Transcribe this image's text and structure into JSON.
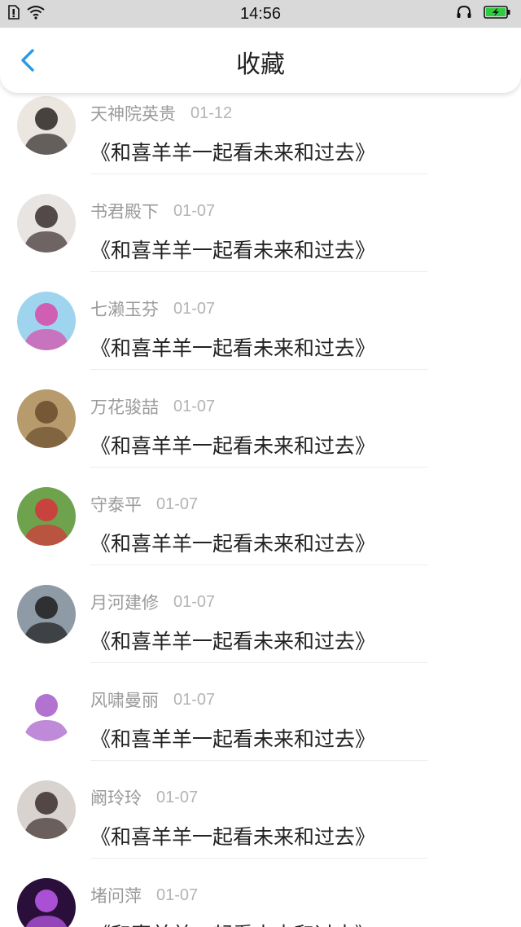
{
  "status_bar": {
    "time": "14:56",
    "battery_color": "#2ecc40"
  },
  "header": {
    "title": "收藏",
    "accent_color": "#2a9ae8"
  },
  "items": [
    {
      "name": "天神院英贵",
      "date": "01-12",
      "title": "《和喜羊羊一起看未来和过去》",
      "avatar": {
        "bg": "#ece6e0",
        "fg": "#2b2522"
      }
    },
    {
      "name": "书君殿下",
      "date": "01-07",
      "title": "《和喜羊羊一起看未来和过去》",
      "avatar": {
        "bg": "#e7e4e2",
        "fg": "#3a2e2e"
      }
    },
    {
      "name": "七濑玉芬",
      "date": "01-07",
      "title": "《和喜羊羊一起看未来和过去》",
      "avatar": {
        "bg": "#9fd4ee",
        "fg": "#d84aa8"
      }
    },
    {
      "name": "万花骏喆",
      "date": "01-07",
      "title": "《和喜羊羊一起看未来和过去》",
      "avatar": {
        "bg": "#b79b6d",
        "fg": "#6a4d2e"
      }
    },
    {
      "name": "守泰平",
      "date": "01-07",
      "title": "《和喜羊羊一起看未来和过去》",
      "avatar": {
        "bg": "#6fa24d",
        "fg": "#d8333c"
      }
    },
    {
      "name": "月河建修",
      "date": "01-07",
      "title": "《和喜羊羊一起看未来和过去》",
      "avatar": {
        "bg": "#8e9aa6",
        "fg": "#1d1d1d"
      }
    },
    {
      "name": "风啸曼丽",
      "date": "01-07",
      "title": "《和喜羊羊一起看未来和过去》",
      "avatar": {
        "bg": "#ffffff",
        "fg": "#a45ac8"
      }
    },
    {
      "name": "阚玲玲",
      "date": "01-07",
      "title": "《和喜羊羊一起看未来和过去》",
      "avatar": {
        "bg": "#d9d3cf",
        "fg": "#3a2e2a"
      }
    },
    {
      "name": "堵问萍",
      "date": "01-07",
      "title": "《和喜羊羊一起看未来和过去》",
      "avatar": {
        "bg": "#2a0f3a",
        "fg": "#c05cf0"
      }
    }
  ]
}
